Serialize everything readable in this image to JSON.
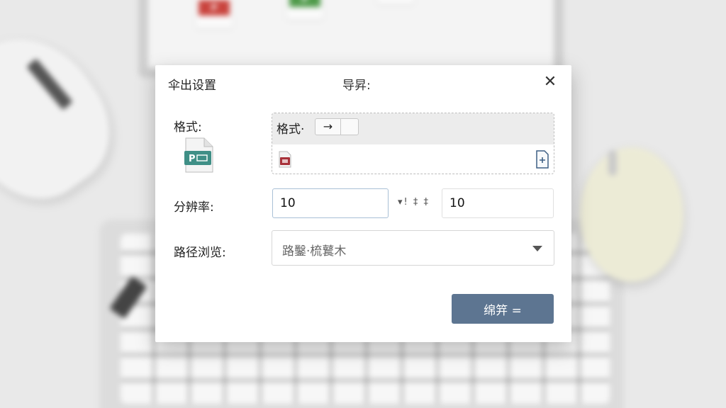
{
  "background": {
    "file_icons": [
      {
        "label": "P",
        "color": "#c9433d"
      },
      {
        "label": "P",
        "color": "#4f9a4a"
      },
      {
        "label": "",
        "color": "#3f8f86"
      }
    ]
  },
  "dialog": {
    "title": "伞出设置",
    "subtitle": "导昇:",
    "close_symbol": "✕",
    "format": {
      "label": "格式:",
      "icon_letter": "P",
      "icon_color": "#3f8f86",
      "box_label": "格式·",
      "toggle_symbol": "→"
    },
    "resolution": {
      "label": "分辨率:",
      "width_value": "10",
      "separator": "▾! ‡ ‡",
      "height_value": "10"
    },
    "path": {
      "label": "路径浏览:",
      "selected": "路鑿·梳鼚木"
    },
    "confirm_label": "绵笄 ="
  }
}
